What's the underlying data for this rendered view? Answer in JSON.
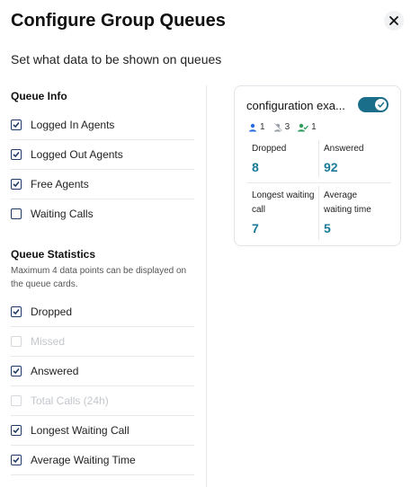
{
  "dialog": {
    "title": "Configure Group Queues",
    "subtitle": "Set what data to be shown on queues"
  },
  "queue_info": {
    "title": "Queue Info",
    "options": [
      {
        "label": "Logged In Agents",
        "checked": true,
        "disabled": false
      },
      {
        "label": "Logged Out Agents",
        "checked": true,
        "disabled": false
      },
      {
        "label": "Free Agents",
        "checked": true,
        "disabled": false
      },
      {
        "label": "Waiting Calls",
        "checked": false,
        "disabled": false
      }
    ]
  },
  "queue_statistics": {
    "title": "Queue Statistics",
    "description": "Maximum 4 data points can be displayed on the queue cards.",
    "options": [
      {
        "label": "Dropped",
        "checked": true,
        "disabled": false
      },
      {
        "label": "Missed",
        "checked": false,
        "disabled": true
      },
      {
        "label": "Answered",
        "checked": true,
        "disabled": false
      },
      {
        "label": "Total Calls (24h)",
        "checked": false,
        "disabled": true
      },
      {
        "label": "Longest Waiting Call",
        "checked": true,
        "disabled": false
      },
      {
        "label": "Average Waiting Time",
        "checked": true,
        "disabled": false
      }
    ]
  },
  "preview_card": {
    "name": "configuration exa...",
    "toggle_on": true,
    "agents": {
      "logged_in": "1",
      "logged_out": "3",
      "free": "1"
    },
    "stats": [
      {
        "label": "Dropped",
        "value": "8"
      },
      {
        "label": "Answered",
        "value": "92"
      },
      {
        "label": "Longest waiting call",
        "value": "7"
      },
      {
        "label": "Average waiting time",
        "value": "5"
      }
    ]
  },
  "colors": {
    "accent": "#1a6e8a",
    "stat_value": "#1a7a97",
    "checkbox": "#1f3a66",
    "logged_in_icon": "#2a6fdb",
    "logged_out_icon": "#9aa0a8",
    "free_icon": "#2f9e5e"
  }
}
